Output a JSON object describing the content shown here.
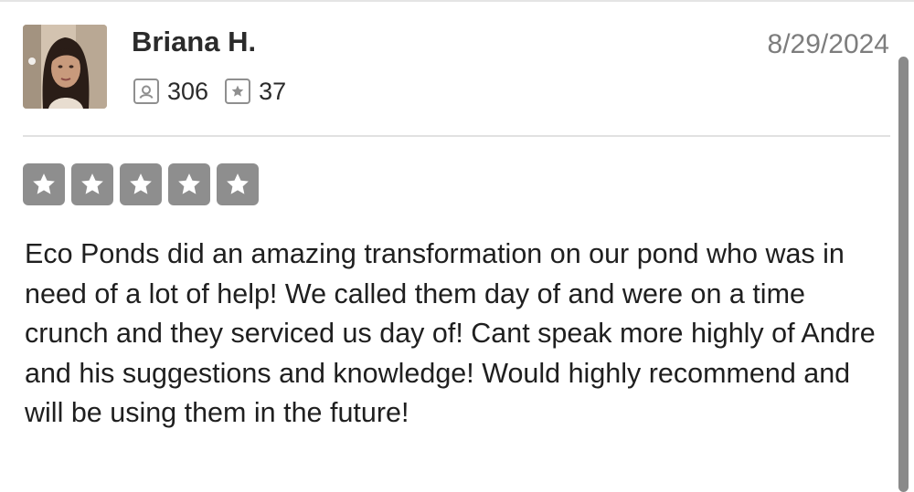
{
  "review": {
    "reviewer_name": "Briana H.",
    "date": "8/29/2024",
    "stats": {
      "reviews_count": "306",
      "reviews_icon": "review-count-icon",
      "photos_count": "37",
      "photos_icon": "star-badge-icon"
    },
    "rating": {
      "stars": 5,
      "max": 5,
      "star_color": "#8e8e8e"
    },
    "text": "Eco Ponds did an amazing transformation on our pond who was in need of a lot of help! We called them day of and were on a time crunch and they serviced us day of! Cant speak more highly of Andre and his suggestions and knowledge! Would highly recommend and will be using them in the future!"
  },
  "colors": {
    "name_text": "#2b2b2b",
    "date_text": "#7d7d7d",
    "divider": "#e1e1e1",
    "icon_border": "#8f8f8f"
  }
}
